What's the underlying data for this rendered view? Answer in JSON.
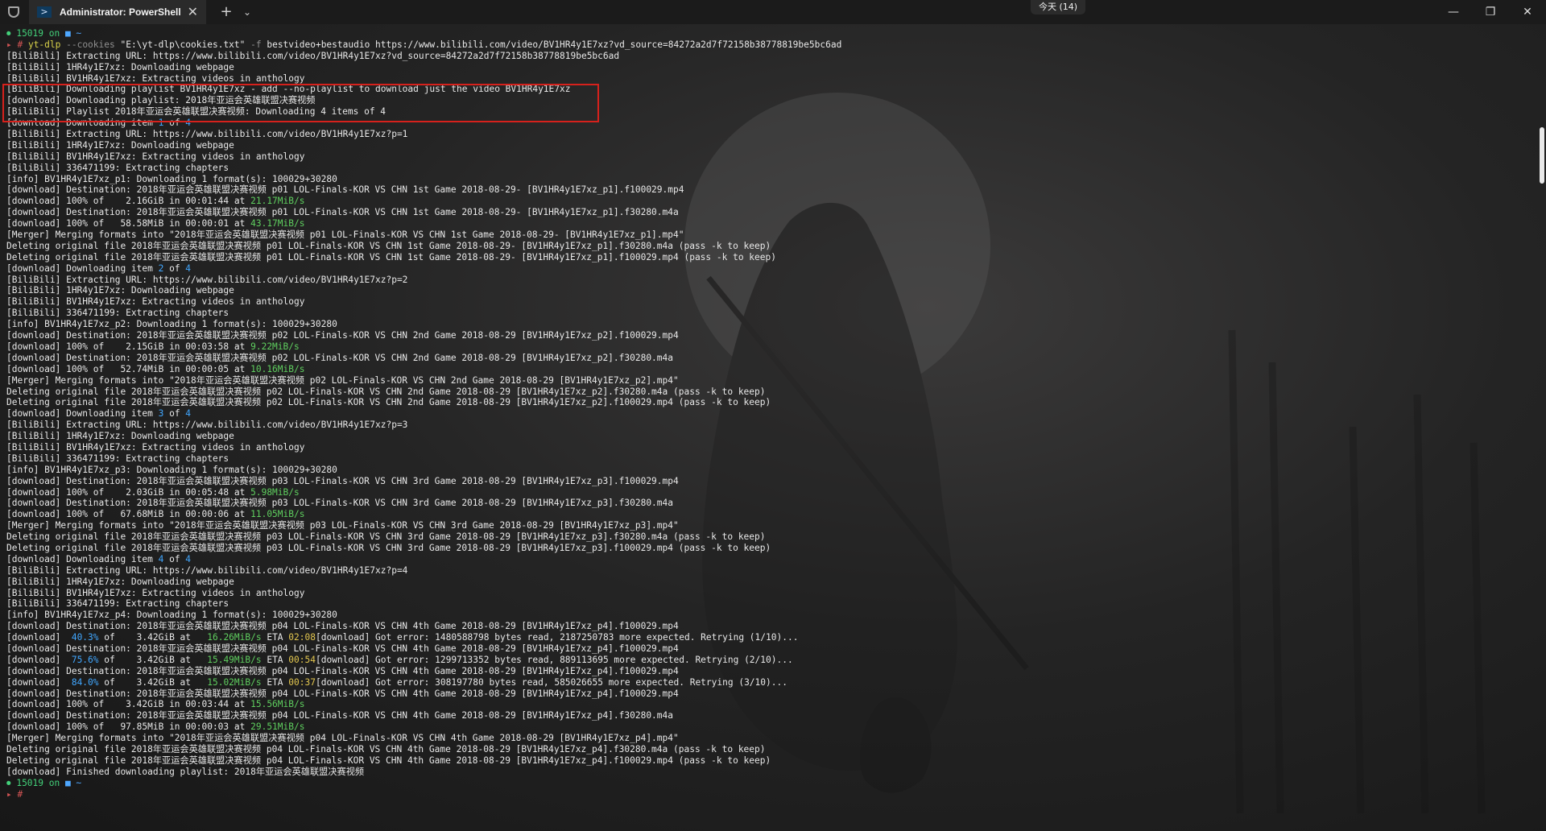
{
  "window": {
    "tab_title": "Administrator: PowerShell",
    "tab_icon": "powershell-icon",
    "center_badge": "今天 (14)",
    "new_tab_symbol": "+",
    "dropdown_symbol": "⌄",
    "close_tab_symbol": "✕",
    "min_symbol": "—",
    "restore_symbol": "❐",
    "close_symbol": "✕"
  },
  "colors": {
    "prompt_green": "#43d17a",
    "path_blue": "#4ea7ff",
    "command_yellow": "#d9d24a",
    "muted": "#8f8f8f",
    "percent_blue": "#41a7ff",
    "speed_green": "#5fcf5f",
    "eta_yellow": "#e2c64f",
    "highlight_red": "#d6211c"
  },
  "terminal": {
    "lines": [
      {
        "segs": [
          {
            "t": "⏺ 15019 on ",
            "c": "#43d17a"
          },
          {
            "t": "■ ~",
            "c": "#4ea7ff"
          }
        ]
      },
      {
        "segs": [
          {
            "t": "▸ # ",
            "c": "#d35454"
          },
          {
            "t": "yt-dlp ",
            "c": "#d9d24a"
          },
          {
            "t": "--cookies ",
            "c": "#8f8f8f"
          },
          {
            "t": "\"E:\\yt-dlp\\cookies.txt\" ",
            "c": "#e8e8e8"
          },
          {
            "t": "-f ",
            "c": "#8f8f8f"
          },
          {
            "t": "bestvideo+bestaudio https://www.bilibili.com/video/BV1HR4y1E7xz?vd_source=84272a2d7f72158b38778819be5bc6ad",
            "c": "#e8e8e8"
          }
        ]
      },
      {
        "segs": [
          {
            "t": "[BiliBili] Extracting URL: https://www.bilibili.com/video/BV1HR4y1E7xz?vd_source=84272a2d7f72158b38778819be5bc6ad",
            "c": "#e8e8e8"
          }
        ]
      },
      {
        "segs": [
          {
            "t": "[BiliBili] 1HR4y1E7xz: Downloading webpage",
            "c": "#e8e8e8"
          }
        ]
      },
      {
        "segs": [
          {
            "t": "[BiliBili] BV1HR4y1E7xz: Extracting videos in anthology",
            "c": "#e8e8e8"
          }
        ]
      },
      {
        "segs": [
          {
            "t": "[BiliBili] Downloading playlist BV1HR4y1E7xz - add --no-playlist to download just the video BV1HR4y1E7xz",
            "c": "#e8e8e8"
          }
        ]
      },
      {
        "segs": [
          {
            "t": "[download] Downloading playlist: 2018年亚运会英雄联盟决赛视频",
            "c": "#e8e8e8"
          }
        ]
      },
      {
        "segs": [
          {
            "t": "[BiliBili] Playlist 2018年亚运会英雄联盟决赛视频: Downloading 4 items of 4",
            "c": "#e8e8e8"
          }
        ]
      },
      {
        "segs": [
          {
            "t": "[download] Downloading item ",
            "c": "#e8e8e8"
          },
          {
            "t": "1",
            "c": "#41a7ff"
          },
          {
            "t": " of ",
            "c": "#e8e8e8"
          },
          {
            "t": "4",
            "c": "#41a7ff"
          }
        ]
      },
      {
        "segs": [
          {
            "t": "[BiliBili] Extracting URL: https://www.bilibili.com/video/BV1HR4y1E7xz?p=1",
            "c": "#e8e8e8"
          }
        ]
      },
      {
        "segs": [
          {
            "t": "[BiliBili] 1HR4y1E7xz: Downloading webpage",
            "c": "#e8e8e8"
          }
        ]
      },
      {
        "segs": [
          {
            "t": "[BiliBili] BV1HR4y1E7xz: Extracting videos in anthology",
            "c": "#e8e8e8"
          }
        ]
      },
      {
        "segs": [
          {
            "t": "[BiliBili] 336471199: Extracting chapters",
            "c": "#e8e8e8"
          }
        ]
      },
      {
        "segs": [
          {
            "t": "[info] BV1HR4y1E7xz_p1: Downloading 1 format(s): 100029+30280",
            "c": "#e8e8e8"
          }
        ]
      },
      {
        "segs": [
          {
            "t": "[download] Destination: 2018年亚运会英雄联盟决赛视频 p01 LOL-Finals-KOR VS CHN 1st Game 2018-08-29- [BV1HR4y1E7xz_p1].f100029.mp4",
            "c": "#e8e8e8"
          }
        ]
      },
      {
        "segs": [
          {
            "t": "[download] 100% of    2.16GiB in 00:01:44 at ",
            "c": "#e8e8e8"
          },
          {
            "t": "21.17MiB/s",
            "c": "#5fcf5f"
          }
        ]
      },
      {
        "segs": [
          {
            "t": "[download] Destination: 2018年亚运会英雄联盟决赛视频 p01 LOL-Finals-KOR VS CHN 1st Game 2018-08-29- [BV1HR4y1E7xz_p1].f30280.m4a",
            "c": "#e8e8e8"
          }
        ]
      },
      {
        "segs": [
          {
            "t": "[download] 100% of   58.58MiB in 00:00:01 at ",
            "c": "#e8e8e8"
          },
          {
            "t": "43.17MiB/s",
            "c": "#5fcf5f"
          }
        ]
      },
      {
        "segs": [
          {
            "t": "[Merger] Merging formats into \"2018年亚运会英雄联盟决赛视频 p01 LOL-Finals-KOR VS CHN 1st Game 2018-08-29- [BV1HR4y1E7xz_p1].mp4\"",
            "c": "#e8e8e8"
          }
        ]
      },
      {
        "segs": [
          {
            "t": "Deleting original file 2018年亚运会英雄联盟决赛视频 p01 LOL-Finals-KOR VS CHN 1st Game 2018-08-29- [BV1HR4y1E7xz_p1].f30280.m4a (pass -k to keep)",
            "c": "#e8e8e8"
          }
        ]
      },
      {
        "segs": [
          {
            "t": "Deleting original file 2018年亚运会英雄联盟决赛视频 p01 LOL-Finals-KOR VS CHN 1st Game 2018-08-29- [BV1HR4y1E7xz_p1].f100029.mp4 (pass -k to keep)",
            "c": "#e8e8e8"
          }
        ]
      },
      {
        "segs": [
          {
            "t": "[download] Downloading item ",
            "c": "#e8e8e8"
          },
          {
            "t": "2",
            "c": "#41a7ff"
          },
          {
            "t": " of ",
            "c": "#e8e8e8"
          },
          {
            "t": "4",
            "c": "#41a7ff"
          }
        ]
      },
      {
        "segs": [
          {
            "t": "[BiliBili] Extracting URL: https://www.bilibili.com/video/BV1HR4y1E7xz?p=2",
            "c": "#e8e8e8"
          }
        ]
      },
      {
        "segs": [
          {
            "t": "[BiliBili] 1HR4y1E7xz: Downloading webpage",
            "c": "#e8e8e8"
          }
        ]
      },
      {
        "segs": [
          {
            "t": "[BiliBili] BV1HR4y1E7xz: Extracting videos in anthology",
            "c": "#e8e8e8"
          }
        ]
      },
      {
        "segs": [
          {
            "t": "[BiliBili] 336471199: Extracting chapters",
            "c": "#e8e8e8"
          }
        ]
      },
      {
        "segs": [
          {
            "t": "[info] BV1HR4y1E7xz_p2: Downloading 1 format(s): 100029+30280",
            "c": "#e8e8e8"
          }
        ]
      },
      {
        "segs": [
          {
            "t": "[download] Destination: 2018年亚运会英雄联盟决赛视频 p02 LOL-Finals-KOR VS CHN 2nd Game 2018-08-29 [BV1HR4y1E7xz_p2].f100029.mp4",
            "c": "#e8e8e8"
          }
        ]
      },
      {
        "segs": [
          {
            "t": "[download] 100% of    2.15GiB in 00:03:58 at ",
            "c": "#e8e8e8"
          },
          {
            "t": "9.22MiB/s",
            "c": "#5fcf5f"
          }
        ]
      },
      {
        "segs": [
          {
            "t": "[download] Destination: 2018年亚运会英雄联盟决赛视频 p02 LOL-Finals-KOR VS CHN 2nd Game 2018-08-29 [BV1HR4y1E7xz_p2].f30280.m4a",
            "c": "#e8e8e8"
          }
        ]
      },
      {
        "segs": [
          {
            "t": "[download] 100% of   52.74MiB in 00:00:05 at ",
            "c": "#e8e8e8"
          },
          {
            "t": "10.16MiB/s",
            "c": "#5fcf5f"
          }
        ]
      },
      {
        "segs": [
          {
            "t": "[Merger] Merging formats into \"2018年亚运会英雄联盟决赛视频 p02 LOL-Finals-KOR VS CHN 2nd Game 2018-08-29 [BV1HR4y1E7xz_p2].mp4\"",
            "c": "#e8e8e8"
          }
        ]
      },
      {
        "segs": [
          {
            "t": "Deleting original file 2018年亚运会英雄联盟决赛视频 p02 LOL-Finals-KOR VS CHN 2nd Game 2018-08-29 [BV1HR4y1E7xz_p2].f30280.m4a (pass -k to keep)",
            "c": "#e8e8e8"
          }
        ]
      },
      {
        "segs": [
          {
            "t": "Deleting original file 2018年亚运会英雄联盟决赛视频 p02 LOL-Finals-KOR VS CHN 2nd Game 2018-08-29 [BV1HR4y1E7xz_p2].f100029.mp4 (pass -k to keep)",
            "c": "#e8e8e8"
          }
        ]
      },
      {
        "segs": [
          {
            "t": "[download] Downloading item ",
            "c": "#e8e8e8"
          },
          {
            "t": "3",
            "c": "#41a7ff"
          },
          {
            "t": " of ",
            "c": "#e8e8e8"
          },
          {
            "t": "4",
            "c": "#41a7ff"
          }
        ]
      },
      {
        "segs": [
          {
            "t": "[BiliBili] Extracting URL: https://www.bilibili.com/video/BV1HR4y1E7xz?p=3",
            "c": "#e8e8e8"
          }
        ]
      },
      {
        "segs": [
          {
            "t": "[BiliBili] 1HR4y1E7xz: Downloading webpage",
            "c": "#e8e8e8"
          }
        ]
      },
      {
        "segs": [
          {
            "t": "[BiliBili] BV1HR4y1E7xz: Extracting videos in anthology",
            "c": "#e8e8e8"
          }
        ]
      },
      {
        "segs": [
          {
            "t": "[BiliBili] 336471199: Extracting chapters",
            "c": "#e8e8e8"
          }
        ]
      },
      {
        "segs": [
          {
            "t": "[info] BV1HR4y1E7xz_p3: Downloading 1 format(s): 100029+30280",
            "c": "#e8e8e8"
          }
        ]
      },
      {
        "segs": [
          {
            "t": "[download] Destination: 2018年亚运会英雄联盟决赛视频 p03 LOL-Finals-KOR VS CHN 3rd Game 2018-08-29 [BV1HR4y1E7xz_p3].f100029.mp4",
            "c": "#e8e8e8"
          }
        ]
      },
      {
        "segs": [
          {
            "t": "[download] 100% of    2.03GiB in 00:05:48 at ",
            "c": "#e8e8e8"
          },
          {
            "t": "5.98MiB/s",
            "c": "#5fcf5f"
          }
        ]
      },
      {
        "segs": [
          {
            "t": "[download] Destination: 2018年亚运会英雄联盟决赛视频 p03 LOL-Finals-KOR VS CHN 3rd Game 2018-08-29 [BV1HR4y1E7xz_p3].f30280.m4a",
            "c": "#e8e8e8"
          }
        ]
      },
      {
        "segs": [
          {
            "t": "[download] 100% of   67.68MiB in 00:00:06 at ",
            "c": "#e8e8e8"
          },
          {
            "t": "11.05MiB/s",
            "c": "#5fcf5f"
          }
        ]
      },
      {
        "segs": [
          {
            "t": "[Merger] Merging formats into \"2018年亚运会英雄联盟决赛视频 p03 LOL-Finals-KOR VS CHN 3rd Game 2018-08-29 [BV1HR4y1E7xz_p3].mp4\"",
            "c": "#e8e8e8"
          }
        ]
      },
      {
        "segs": [
          {
            "t": "Deleting original file 2018年亚运会英雄联盟决赛视频 p03 LOL-Finals-KOR VS CHN 3rd Game 2018-08-29 [BV1HR4y1E7xz_p3].f30280.m4a (pass -k to keep)",
            "c": "#e8e8e8"
          }
        ]
      },
      {
        "segs": [
          {
            "t": "Deleting original file 2018年亚运会英雄联盟决赛视频 p03 LOL-Finals-KOR VS CHN 3rd Game 2018-08-29 [BV1HR4y1E7xz_p3].f100029.mp4 (pass -k to keep)",
            "c": "#e8e8e8"
          }
        ]
      },
      {
        "segs": [
          {
            "t": "[download] Downloading item ",
            "c": "#e8e8e8"
          },
          {
            "t": "4",
            "c": "#41a7ff"
          },
          {
            "t": " of ",
            "c": "#e8e8e8"
          },
          {
            "t": "4",
            "c": "#41a7ff"
          }
        ]
      },
      {
        "segs": [
          {
            "t": "[BiliBili] Extracting URL: https://www.bilibili.com/video/BV1HR4y1E7xz?p=4",
            "c": "#e8e8e8"
          }
        ]
      },
      {
        "segs": [
          {
            "t": "[BiliBili] 1HR4y1E7xz: Downloading webpage",
            "c": "#e8e8e8"
          }
        ]
      },
      {
        "segs": [
          {
            "t": "[BiliBili] BV1HR4y1E7xz: Extracting videos in anthology",
            "c": "#e8e8e8"
          }
        ]
      },
      {
        "segs": [
          {
            "t": "[BiliBili] 336471199: Extracting chapters",
            "c": "#e8e8e8"
          }
        ]
      },
      {
        "segs": [
          {
            "t": "[info] BV1HR4y1E7xz_p4: Downloading 1 format(s): 100029+30280",
            "c": "#e8e8e8"
          }
        ]
      },
      {
        "segs": [
          {
            "t": "[download] Destination: 2018年亚运会英雄联盟决赛视频 p04 LOL-Finals-KOR VS CHN 4th Game 2018-08-29 [BV1HR4y1E7xz_p4].f100029.mp4",
            "c": "#e8e8e8"
          }
        ]
      },
      {
        "segs": [
          {
            "t": "[download]  ",
            "c": "#e8e8e8"
          },
          {
            "t": "40.3%",
            "c": "#41a7ff"
          },
          {
            "t": " of    3.42GiB at   ",
            "c": "#e8e8e8"
          },
          {
            "t": "16.26MiB/s",
            "c": "#5fcf5f"
          },
          {
            "t": " ETA ",
            "c": "#e8e8e8"
          },
          {
            "t": "02:08",
            "c": "#e2c64f"
          },
          {
            "t": "[download] Got error: 1480588798 bytes read, 2187250783 more expected. Retrying (1/10)...",
            "c": "#e8e8e8"
          }
        ]
      },
      {
        "segs": [
          {
            "t": "[download] Destination: 2018年亚运会英雄联盟决赛视频 p04 LOL-Finals-KOR VS CHN 4th Game 2018-08-29 [BV1HR4y1E7xz_p4].f100029.mp4",
            "c": "#e8e8e8"
          }
        ]
      },
      {
        "segs": [
          {
            "t": "[download]  ",
            "c": "#e8e8e8"
          },
          {
            "t": "75.6%",
            "c": "#41a7ff"
          },
          {
            "t": " of    3.42GiB at   ",
            "c": "#e8e8e8"
          },
          {
            "t": "15.49MiB/s",
            "c": "#5fcf5f"
          },
          {
            "t": " ETA ",
            "c": "#e8e8e8"
          },
          {
            "t": "00:54",
            "c": "#e2c64f"
          },
          {
            "t": "[download] Got error: 1299713352 bytes read, 889113695 more expected. Retrying (2/10)...",
            "c": "#e8e8e8"
          }
        ]
      },
      {
        "segs": [
          {
            "t": "[download] Destination: 2018年亚运会英雄联盟决赛视频 p04 LOL-Finals-KOR VS CHN 4th Game 2018-08-29 [BV1HR4y1E7xz_p4].f100029.mp4",
            "c": "#e8e8e8"
          }
        ]
      },
      {
        "segs": [
          {
            "t": "[download]  ",
            "c": "#e8e8e8"
          },
          {
            "t": "84.0%",
            "c": "#41a7ff"
          },
          {
            "t": " of    3.42GiB at   ",
            "c": "#e8e8e8"
          },
          {
            "t": "15.02MiB/s",
            "c": "#5fcf5f"
          },
          {
            "t": " ETA ",
            "c": "#e8e8e8"
          },
          {
            "t": "00:37",
            "c": "#e2c64f"
          },
          {
            "t": "[download] Got error: 308197780 bytes read, 585026655 more expected. Retrying (3/10)...",
            "c": "#e8e8e8"
          }
        ]
      },
      {
        "segs": [
          {
            "t": "[download] Destination: 2018年亚运会英雄联盟决赛视频 p04 LOL-Finals-KOR VS CHN 4th Game 2018-08-29 [BV1HR4y1E7xz_p4].f100029.mp4",
            "c": "#e8e8e8"
          }
        ]
      },
      {
        "segs": [
          {
            "t": "[download] 100% of    3.42GiB in 00:03:44 at ",
            "c": "#e8e8e8"
          },
          {
            "t": "15.56MiB/s",
            "c": "#5fcf5f"
          }
        ]
      },
      {
        "segs": [
          {
            "t": "[download] Destination: 2018年亚运会英雄联盟决赛视频 p04 LOL-Finals-KOR VS CHN 4th Game 2018-08-29 [BV1HR4y1E7xz_p4].f30280.m4a",
            "c": "#e8e8e8"
          }
        ]
      },
      {
        "segs": [
          {
            "t": "[download] 100% of   97.85MiB in 00:00:03 at ",
            "c": "#e8e8e8"
          },
          {
            "t": "29.51MiB/s",
            "c": "#5fcf5f"
          }
        ]
      },
      {
        "segs": [
          {
            "t": "[Merger] Merging formats into \"2018年亚运会英雄联盟决赛视频 p04 LOL-Finals-KOR VS CHN 4th Game 2018-08-29 [BV1HR4y1E7xz_p4].mp4\"",
            "c": "#e8e8e8"
          }
        ]
      },
      {
        "segs": [
          {
            "t": "Deleting original file 2018年亚运会英雄联盟决赛视频 p04 LOL-Finals-KOR VS CHN 4th Game 2018-08-29 [BV1HR4y1E7xz_p4].f30280.m4a (pass -k to keep)",
            "c": "#e8e8e8"
          }
        ]
      },
      {
        "segs": [
          {
            "t": "Deleting original file 2018年亚运会英雄联盟决赛视频 p04 LOL-Finals-KOR VS CHN 4th Game 2018-08-29 [BV1HR4y1E7xz_p4].f100029.mp4 (pass -k to keep)",
            "c": "#e8e8e8"
          }
        ]
      },
      {
        "segs": [
          {
            "t": "[download] Finished downloading playlist: 2018年亚运会英雄联盟决赛视频",
            "c": "#e8e8e8"
          }
        ]
      },
      {
        "segs": [
          {
            "t": "⏺ 15019 on ",
            "c": "#43d17a"
          },
          {
            "t": "■ ~",
            "c": "#4ea7ff"
          }
        ]
      },
      {
        "segs": [
          {
            "t": "▸ #",
            "c": "#d35454"
          }
        ]
      }
    ]
  }
}
